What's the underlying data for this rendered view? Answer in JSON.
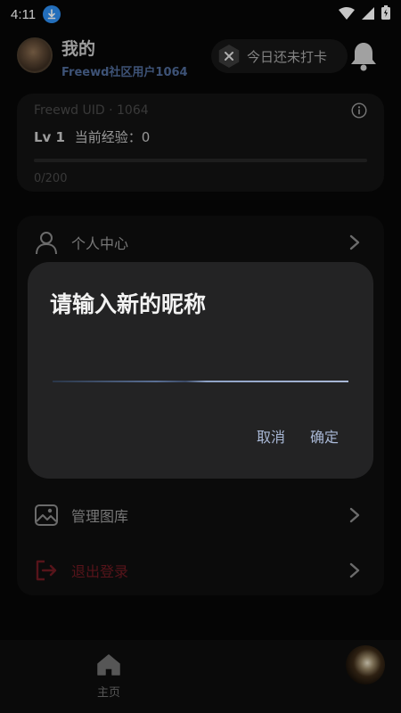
{
  "status_bar": {
    "time": "4:11"
  },
  "header": {
    "title": "我的",
    "username": "Freewd社区用户1064",
    "checkin_label": "今日还未打卡"
  },
  "level_card": {
    "uid": "Freewd UID · 1064",
    "level": "Lv 1",
    "exp_text": "当前经验：0",
    "progress_text": "0/200",
    "progress_fraction": 0
  },
  "menu": {
    "items": [
      {
        "label": "个人中心",
        "icon": "person-icon"
      },
      {
        "label": "管理图库",
        "icon": "image-icon"
      },
      {
        "label": "退出登录",
        "icon": "logout-icon"
      }
    ]
  },
  "dialog": {
    "title": "请输入新的昵称",
    "input_value": "",
    "cancel_label": "取消",
    "confirm_label": "确定"
  },
  "bottom_nav": {
    "home_label": "主页"
  },
  "colors": {
    "accent": "#4f6a98",
    "dialog_button": "#a9b8d6",
    "danger": "#6f1a22"
  }
}
